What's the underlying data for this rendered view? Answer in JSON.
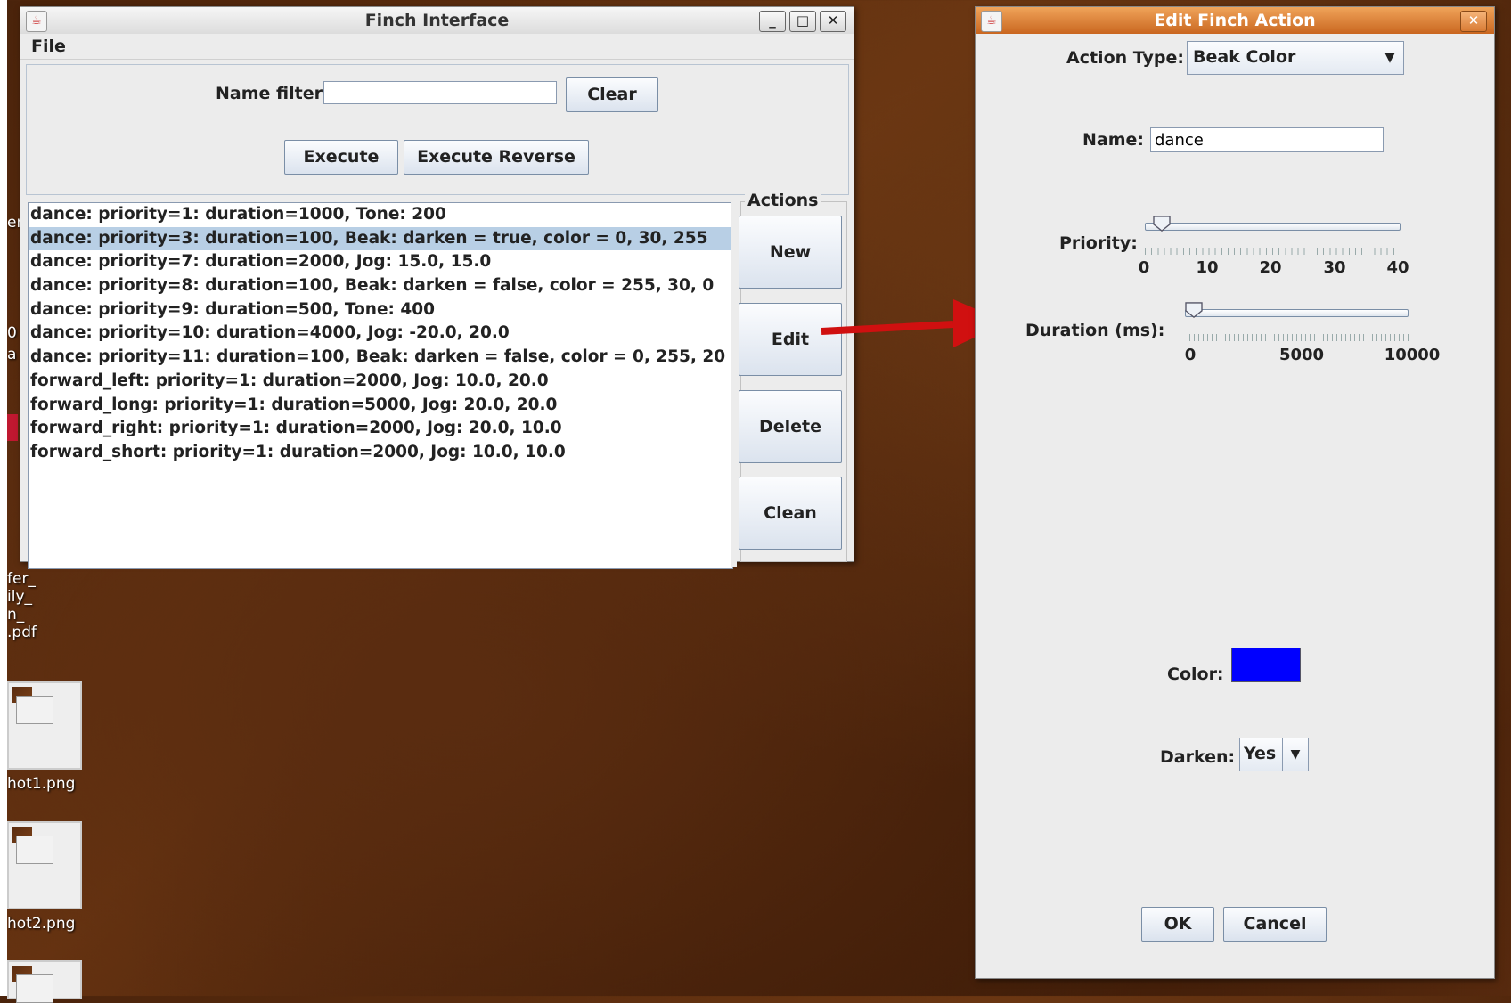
{
  "desktop": {
    "left_texts": [
      "er",
      "0",
      "a"
    ],
    "file_label_lines": [
      "fer_",
      "ily_",
      "n_",
      ".pdf"
    ],
    "icons": [
      {
        "label": "hot1.png"
      },
      {
        "label": "hot2.png"
      }
    ]
  },
  "main_window": {
    "title": "Finch Interface",
    "menu": {
      "file": "File"
    },
    "name_filter_label": "Name filter:",
    "name_filter_value": "",
    "clear_label": "Clear",
    "execute_label": "Execute",
    "execute_reverse_label": "Execute Reverse",
    "actions_group_title": "Actions",
    "new_label": "New",
    "edit_label": "Edit",
    "delete_label": "Delete",
    "clean_label": "Clean",
    "list_items": [
      "dance: priority=1: duration=1000, Tone: 200",
      "dance: priority=3: duration=100, Beak: darken = true, color = 0, 30, 255",
      "dance: priority=7: duration=2000, Jog: 15.0, 15.0",
      "dance: priority=8: duration=100, Beak: darken = false, color = 255, 30, 0",
      "dance: priority=9: duration=500, Tone: 400",
      "dance: priority=10: duration=4000, Jog: -20.0, 20.0",
      "dance: priority=11: duration=100, Beak: darken = false, color = 0, 255, 20",
      "forward_left: priority=1: duration=2000, Jog: 10.0, 20.0",
      "forward_long: priority=1: duration=5000, Jog: 20.0, 20.0",
      "forward_right: priority=1: duration=2000, Jog: 20.0, 10.0",
      "forward_short: priority=1: duration=2000, Jog: 10.0, 10.0"
    ],
    "selected_index": 1
  },
  "edit_dialog": {
    "title": "Edit Finch Action",
    "action_type_label": "Action Type:",
    "action_type_value": "Beak Color",
    "name_label": "Name:",
    "name_value": "dance",
    "priority_label": "Priority:",
    "priority_ticks": [
      "0",
      "10",
      "20",
      "30",
      "40"
    ],
    "priority_value": 3,
    "duration_label": "Duration (ms):",
    "duration_ticks": [
      "0",
      "5000",
      "10000"
    ],
    "duration_value": 100,
    "color_label": "Color:",
    "color_value": "#0000ff",
    "darken_label": "Darken:",
    "darken_value": "Yes",
    "ok_label": "OK",
    "cancel_label": "Cancel"
  },
  "colors": {
    "selection": "#b8cfe5",
    "dialog_title": "#d9742c",
    "arrow": "#d01010"
  }
}
